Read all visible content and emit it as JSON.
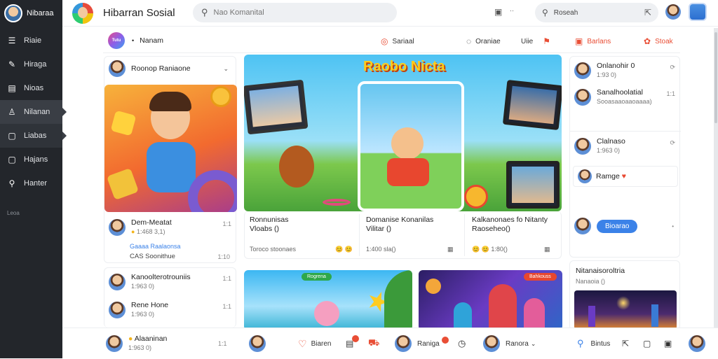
{
  "sidebar": {
    "title": "Nibaraa",
    "items": [
      {
        "label": "Riaie",
        "icon": "list-icon"
      },
      {
        "label": "Hiraga",
        "icon": "pen-icon"
      },
      {
        "label": "Nioas",
        "icon": "document-icon"
      },
      {
        "label": "Nilanan",
        "icon": "user-icon"
      },
      {
        "label": "Liabas",
        "icon": "document-icon"
      },
      {
        "label": "Hajans",
        "icon": "square-icon"
      },
      {
        "label": "Hanter",
        "icon": "link-icon"
      }
    ],
    "footer": "Leoa"
  },
  "topbar": {
    "title": "Hibarran Sosial",
    "search_placeholder": "Nao Komanital",
    "secondary_search": "Roseah",
    "dots": "··"
  },
  "subbar": {
    "logo_text": "Tutu",
    "label": "Nanam",
    "items": [
      {
        "label": "Sariaal",
        "icon": "chat-icon"
      },
      {
        "label": "Oraniae",
        "icon": "chat-icon"
      },
      {
        "label": "Uiie",
        "icon": "text-icon"
      },
      {
        "label": "Barlans",
        "icon": "grid-icon"
      },
      {
        "label": "Stoak",
        "icon": "gift-icon"
      }
    ]
  },
  "left_panel": {
    "header": "Roonop Raniaone",
    "post": {
      "title": "Dem-Meatat",
      "sub": "1:468 3,1)",
      "time": "1:1",
      "link": "Gaaaa Raalaonsa",
      "stats": "CAS Soonithue",
      "time2": "1:10"
    },
    "rows": [
      {
        "title": "Kanoolterotrouniis",
        "sub": "1:963 0)",
        "time": "1:1"
      },
      {
        "title": "Rene Hone",
        "sub": "1:963 0)",
        "time": "1:1"
      },
      {
        "title": "Alaaninan",
        "sub": "1:963 0)",
        "time": "1:1"
      }
    ]
  },
  "feed": {
    "banner": "Raobo Nicta",
    "cards": [
      {
        "caption": "Ronnunisas\nVloabs ()",
        "meta": "Toroco stoonaes",
        "icons": "😊 😊"
      },
      {
        "caption": "Domanise Konanilas\nVilitar ()",
        "meta": "1:400 sla()",
        "icons": "▦"
      },
      {
        "caption": "Kalkanonaes fo Nitanty\nRaoseheo()",
        "meta": "😊 😊 1:80()",
        "icons": "▦"
      }
    ],
    "bottom_badge1": "Rogrena",
    "bottom_badge2": "Bahkouss"
  },
  "right_panel": {
    "rows": [
      {
        "title": "Onlanohir 0",
        "sub": "1:93 0)",
        "time": "⟳"
      },
      {
        "title": "Sanalhoolatial",
        "sub": "Sooasaaoaaoaaaa)",
        "time": "1:1"
      },
      {
        "title": "Clalnaso",
        "sub": "1:963 0)",
        "time": "⟳"
      },
      {
        "title": "Ramge",
        "sub": "",
        "time": ""
      }
    ],
    "button": "Bioarao",
    "dot": "•",
    "card_title": "Nitanaisoroltria",
    "card_sub": "Nanaoia ()"
  },
  "bottombar": {
    "items": [
      {
        "label": "Biaren",
        "icon": "heart-icon"
      },
      {
        "label": "Raniga",
        "icon": "chat-icon"
      },
      {
        "label": "Ranora",
        "icon": "user-icon"
      },
      {
        "label": "Bintus",
        "icon": "run-icon"
      }
    ]
  },
  "colors": {
    "accent": "#3b82e8",
    "sidebar": "#23262b",
    "warning": "#e94e35"
  }
}
